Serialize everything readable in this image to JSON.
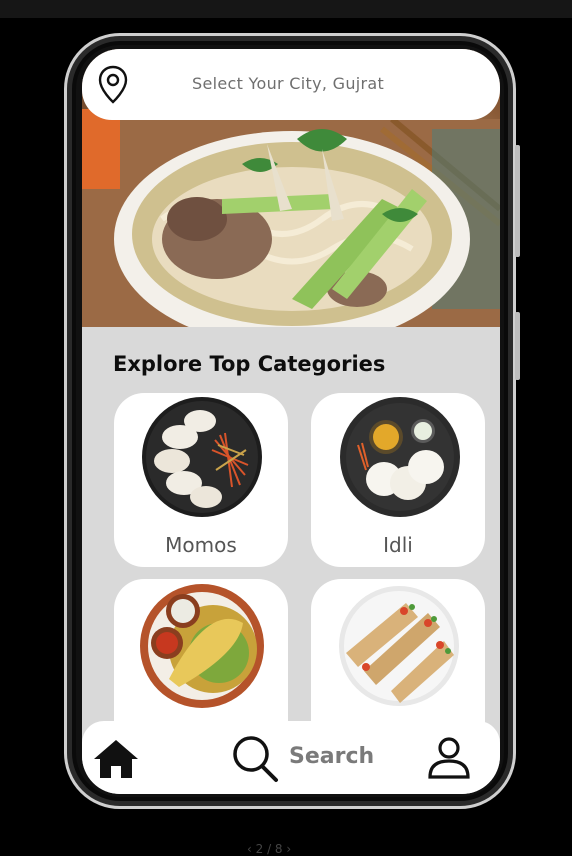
{
  "location_bar": {
    "text": "Select Your City, Gujrat",
    "icon": "location-pin-icon"
  },
  "categories_section": {
    "title": "Explore Top Categories",
    "items": [
      {
        "label": "Momos"
      },
      {
        "label": "Idli"
      },
      {
        "label": ""
      },
      {
        "label": ""
      }
    ]
  },
  "bottom_nav": {
    "home_icon": "home-icon",
    "search_label": "Search",
    "search_icon": "search-icon",
    "profile_icon": "profile-icon"
  },
  "pager": "‹ 2 / 8 ›",
  "colors": {
    "background": "#000000",
    "screen": "#d9d9d9",
    "card": "#ffffff",
    "text": "#0d0d0d"
  }
}
